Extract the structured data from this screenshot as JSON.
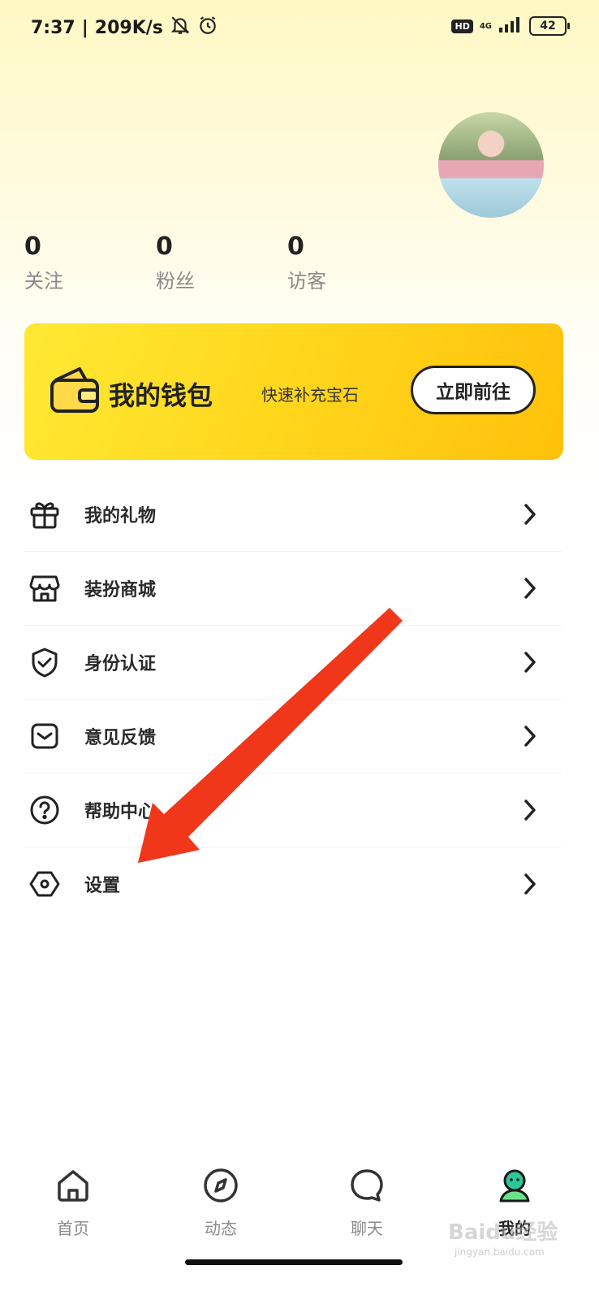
{
  "status_bar": {
    "time": "7:37",
    "speed": "209K/s",
    "hd": "HD",
    "network": "4G",
    "battery": "42"
  },
  "profile": {
    "stats": [
      {
        "value": "0",
        "label": "关注"
      },
      {
        "value": "0",
        "label": "粉丝"
      },
      {
        "value": "0",
        "label": "访客"
      }
    ]
  },
  "wallet": {
    "title": "我的钱包",
    "subtitle": "快速补充宝石",
    "button": "立即前往"
  },
  "menu": [
    {
      "label": "我的礼物",
      "icon": "gift-icon"
    },
    {
      "label": "装扮商城",
      "icon": "store-icon"
    },
    {
      "label": "身份认证",
      "icon": "shield-check-icon"
    },
    {
      "label": "意见反馈",
      "icon": "feedback-icon"
    },
    {
      "label": "帮助中心",
      "icon": "help-icon"
    },
    {
      "label": "设置",
      "icon": "settings-icon"
    }
  ],
  "tabs": [
    {
      "label": "首页",
      "icon": "home-icon"
    },
    {
      "label": "动态",
      "icon": "compass-icon"
    },
    {
      "label": "聊天",
      "icon": "chat-icon"
    },
    {
      "label": "我的",
      "icon": "profile-icon",
      "active": true
    }
  ],
  "annotation": {
    "color": "#f0371a"
  },
  "watermark": {
    "text": "Baidu经验",
    "sub": "jingyan.baidu.com"
  }
}
